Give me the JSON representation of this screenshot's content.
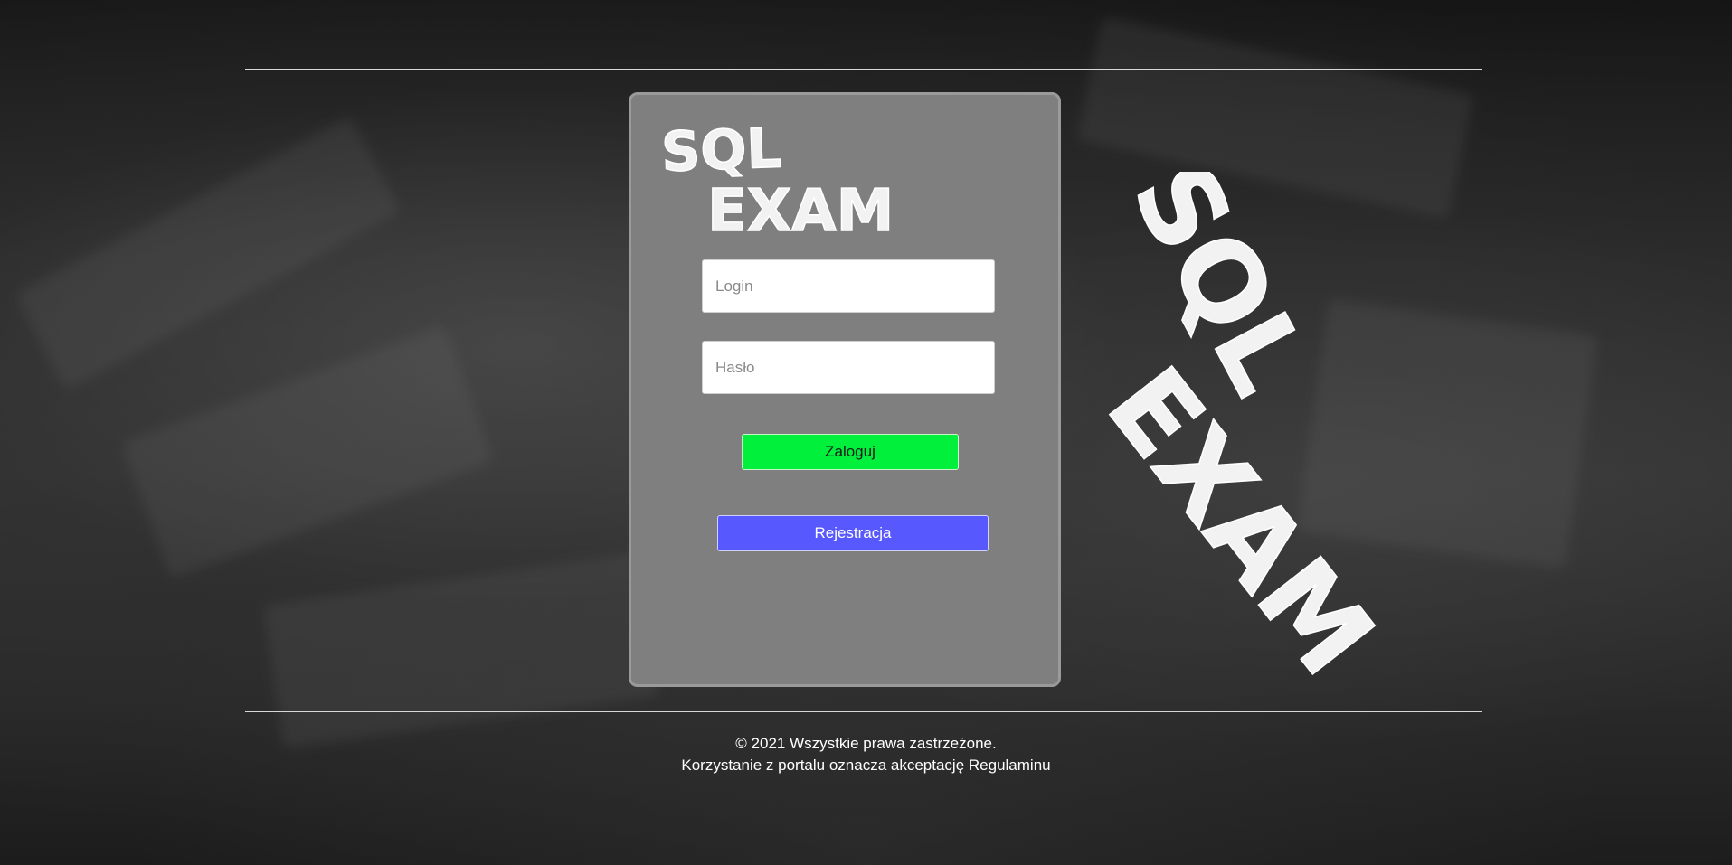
{
  "logo": {
    "line1": "SQL",
    "line2": "EXAM"
  },
  "form": {
    "login_placeholder": "Login",
    "password_placeholder": "Hasło",
    "login_button": "Zaloguj",
    "register_button": "Rejestracja"
  },
  "footer": {
    "copyright": "© 2021 Wszystkie prawa zastrzeżone.",
    "terms": "Korzystanie z portalu oznacza akceptację Regulaminu"
  },
  "colors": {
    "login_button": "#00f03c",
    "register_button": "#5858ff",
    "panel": "#7f7f7f",
    "background": "#2c2c2c"
  }
}
